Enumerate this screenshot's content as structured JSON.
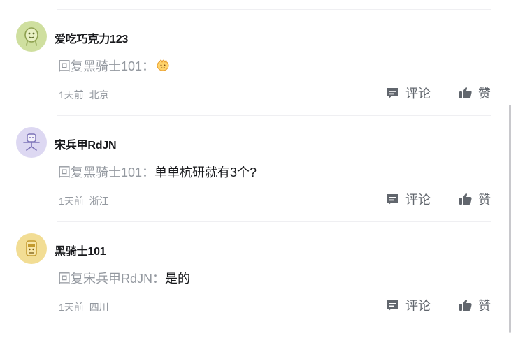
{
  "comments": [
    {
      "username": "爱吃巧克力123",
      "reply_prefix": "回复黑骑士101：",
      "reply_text": "",
      "has_emoji": true,
      "time": "1天前",
      "location": "北京",
      "comment_label": "评论",
      "like_label": "赞",
      "avatar_icon": "green-creature-avatar-icon",
      "avatar_color": "#cfdf9f"
    },
    {
      "username": "宋兵甲RdJN",
      "reply_prefix": "回复黑骑士101：",
      "reply_text": "单单杭研就有3个?",
      "has_emoji": false,
      "time": "1天前",
      "location": "浙江",
      "comment_label": "评论",
      "like_label": "赞",
      "avatar_icon": "robot-chair-avatar-icon",
      "avatar_color": "#ddd8f2"
    },
    {
      "username": "黑骑士101",
      "reply_prefix": "回复宋兵甲RdJN：",
      "reply_text": "是的",
      "has_emoji": false,
      "time": "1天前",
      "location": "四川",
      "comment_label": "评论",
      "like_label": "赞",
      "avatar_icon": "yellow-block-avatar-icon",
      "avatar_color": "#f2dd94"
    }
  ],
  "colors": {
    "username": "#18191c",
    "secondary_text": "#9499a0",
    "action_text": "#61666d",
    "divider": "#efeff2"
  }
}
